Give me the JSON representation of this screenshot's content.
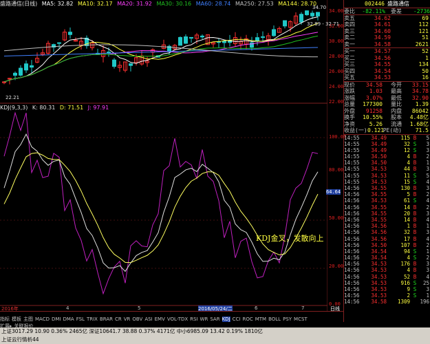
{
  "top_bar": {
    "name": "盛路通信(日线)",
    "ma5": "MA5: 32.82",
    "ma10": "MA10: 32.17",
    "ma20": "MA20: 31.92",
    "ma30": "MA30: 30.16",
    "ma60": "MA60: 28.74",
    "ma250": "MA250: 27.53",
    "ma144": "MA144: 28.70"
  },
  "kdj_bar": {
    "name": "KDJ(9,3,3)",
    "k": "K: 80.31",
    "d": "D: 71.51",
    "j": "J: 97.91"
  },
  "price_axis": [
    "34.00",
    "32.00",
    "30.00",
    "28.00",
    "26.00",
    "24.00",
    "22.00"
  ],
  "kdj_axis": [
    "100.00",
    "80.00",
    "64.64",
    "50.00",
    "20.00",
    "0.00"
  ],
  "annotations": {
    "high": "34.70",
    "mid": "32.89 - 32.71",
    "low": "22.21",
    "kdj_note": "KDJ金叉，发散向上"
  },
  "stock": {
    "code": "002446",
    "name": "盛路通信"
  },
  "ratio": {
    "l1": "委比",
    "v1": "-82.11%",
    "l2": "委差",
    "v2": "-2736"
  },
  "asks": [
    {
      "l": "卖五",
      "p": "34.62",
      "v": "69"
    },
    {
      "l": "卖四",
      "p": "34.61",
      "v": "112"
    },
    {
      "l": "卖三",
      "p": "34.60",
      "v": "121"
    },
    {
      "l": "卖二",
      "p": "34.59",
      "v": "51"
    },
    {
      "l": "卖一",
      "p": "34.58",
      "v": "2621"
    }
  ],
  "bids": [
    {
      "l": "买一",
      "p": "34.57",
      "v": "52"
    },
    {
      "l": "买二",
      "p": "34.56",
      "v": "1"
    },
    {
      "l": "买三",
      "p": "34.55",
      "v": "134"
    },
    {
      "l": "买四",
      "p": "34.54",
      "v": "50"
    },
    {
      "l": "买五",
      "p": "34.53",
      "v": "16"
    }
  ],
  "quote": [
    {
      "l1": "现价",
      "v1": "34.58",
      "l2": "今开",
      "v2": "33.15"
    },
    {
      "l1": "涨跌",
      "v1": "1.03",
      "l2": "最高",
      "v2": "34.78"
    },
    {
      "l1": "涨幅",
      "v1": "3.07%",
      "l2": "最低",
      "v2": "32.90"
    },
    {
      "l1": "总量",
      "v1": "177300",
      "l2": "量比",
      "v2": "1.39"
    },
    {
      "l1": "外盘",
      "v1": "91258",
      "l2": "内盘",
      "v2": "86042"
    },
    {
      "l1": "换手",
      "v1": "10.55%",
      "l2": "股本",
      "v2": "4.48亿"
    },
    {
      "l1": "净资",
      "v1": "5.26",
      "l2": "流通",
      "v2": "1.68亿"
    },
    {
      "l1": "收益(一)",
      "v1": "0.121",
      "l2": "PE(动)",
      "v2": "71.5"
    }
  ],
  "ticks": [
    {
      "t": "14:55",
      "p": "34.49",
      "v": "115",
      "d": "B",
      "n": "5"
    },
    {
      "t": "14:55",
      "p": "34.49",
      "v": "32",
      "d": "S",
      "n": "3"
    },
    {
      "t": "14:55",
      "p": "34.49",
      "v": "12",
      "d": "S",
      "n": "3"
    },
    {
      "t": "14:55",
      "p": "34.50",
      "v": "4",
      "d": "B",
      "n": "2"
    },
    {
      "t": "14:55",
      "p": "34.50",
      "v": "4",
      "d": "B",
      "n": "1"
    },
    {
      "t": "14:55",
      "p": "34.53",
      "v": "44",
      "d": "B",
      "n": "3"
    },
    {
      "t": "14:55",
      "p": "34.53",
      "v": "11",
      "d": "S",
      "n": "5"
    },
    {
      "t": "14:55",
      "p": "34.53",
      "v": "15",
      "d": "S",
      "n": "4"
    },
    {
      "t": "14:56",
      "p": "34.55",
      "v": "130",
      "d": "B",
      "n": "3"
    },
    {
      "t": "14:56",
      "p": "34.55",
      "v": "5",
      "d": "B",
      "n": "2"
    },
    {
      "t": "14:56",
      "p": "34.53",
      "v": "61",
      "d": "S",
      "n": "4"
    },
    {
      "t": "14:56",
      "p": "34.55",
      "v": "14",
      "d": "B",
      "n": "2"
    },
    {
      "t": "14:56",
      "p": "34.55",
      "v": "20",
      "d": "B",
      "n": "3"
    },
    {
      "t": "14:56",
      "p": "34.55",
      "v": "14",
      "d": "B",
      "n": "4"
    },
    {
      "t": "14:56",
      "p": "34.56",
      "v": "1",
      "d": "B",
      "n": "1"
    },
    {
      "t": "14:56",
      "p": "34.56",
      "v": "32",
      "d": "B",
      "n": "3"
    },
    {
      "t": "14:56",
      "p": "34.56",
      "v": "17",
      "d": "B",
      "n": "4"
    },
    {
      "t": "14:56",
      "p": "34.50",
      "v": "107",
      "d": "B",
      "n": "2"
    },
    {
      "t": "14:56",
      "p": "34.54",
      "v": "94",
      "d": "S",
      "n": "1"
    },
    {
      "t": "14:56",
      "p": "34.54",
      "v": "4",
      "d": "S",
      "n": "2"
    },
    {
      "t": "14:56",
      "p": "34.53",
      "v": "176",
      "d": "B",
      "n": "3"
    },
    {
      "t": "14:56",
      "p": "34.53",
      "v": "4",
      "d": "B",
      "n": "3"
    },
    {
      "t": "14:56",
      "p": "34.53",
      "v": "52",
      "d": "B",
      "n": "4"
    },
    {
      "t": "14:56",
      "p": "34.53",
      "v": "916",
      "d": "S",
      "n": "25"
    },
    {
      "t": "14:56",
      "p": "34.53",
      "v": "9",
      "d": "S",
      "n": "3"
    },
    {
      "t": "14:56",
      "p": "34.53",
      "v": "2",
      "d": "S",
      "n": "1"
    },
    {
      "t": "14:56",
      "p": "34.58",
      "v": "1309",
      "d": "",
      "n": "196"
    }
  ],
  "dates": {
    "d1": "2016年",
    "d2": "4",
    "d3": "5",
    "d4": "2016/05/24/二",
    "d5": "6",
    "d6": "7"
  },
  "tabs": [
    "指标",
    "模板",
    "主图",
    "MACD",
    "DMI",
    "DMA",
    "FSL",
    "TRIX",
    "BRAR",
    "CR",
    "VR",
    "OBV",
    "ASI",
    "EMV",
    "VOL-TDX",
    "RSI",
    "WR",
    "SAR",
    "KDJ",
    "CCI",
    "ROC",
    "MTM",
    "BOLL",
    "PSY",
    "MCST"
  ],
  "tabs2": [
    "扩展▸",
    "关联报价"
  ],
  "right_tabs": [
    "日线",
    "⋮"
  ],
  "status": {
    "line1": "上证3017.29  10.90  0.36%  2465亿   深证10641.7  38.88  0.37%  4171亿   中小6985.09  13.42  0.19%  1810亿",
    "line2": "上证云行情析44"
  },
  "colors": {
    "up": "#ff3030",
    "down": "#20c8c8",
    "ma5": "#ffffff",
    "ma10": "#ffff40",
    "ma20": "#ff40ff",
    "ma30": "#20c020",
    "kline": "#e0e0e0",
    "dline": "#ffff60",
    "jline": "#c020c0"
  }
}
